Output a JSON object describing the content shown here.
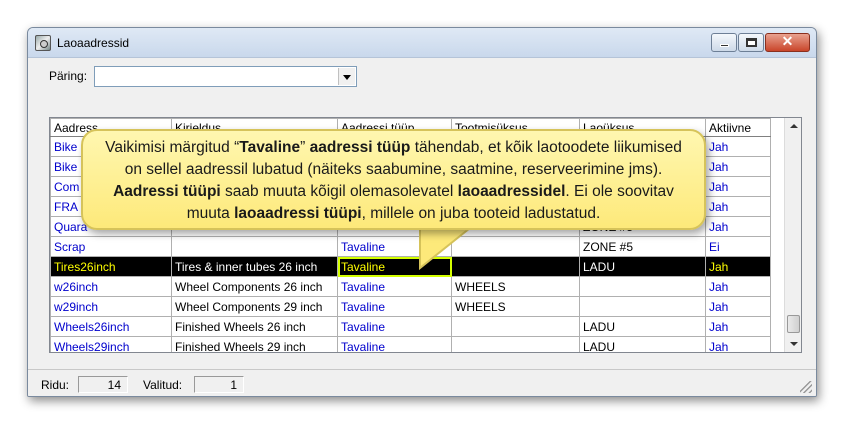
{
  "window": {
    "title": "Laoaadressid"
  },
  "query": {
    "label": "Päring:",
    "value": ""
  },
  "grid": {
    "columns": [
      "Aadress",
      "Kirjeldus",
      "Aadressi tüüp",
      "Tootmisüksus",
      "Laoüksus",
      "Aktiivne"
    ],
    "rows": [
      [
        "Bike",
        "",
        "",
        "",
        "",
        "Jah"
      ],
      [
        "Bike",
        "",
        "",
        "",
        "",
        "Jah"
      ],
      [
        "Com",
        "",
        "",
        "",
        "",
        "Jah"
      ],
      [
        "FRA",
        "",
        "",
        "",
        "",
        "Jah"
      ],
      [
        "Quara",
        "",
        "",
        "",
        "ZONE #5",
        "Jah"
      ],
      [
        "Scrap",
        "",
        "Tavaline",
        "",
        "ZONE #5",
        "Ei"
      ],
      [
        "Tires26inch",
        "Tires & inner tubes 26 inch",
        "Tavaline",
        "",
        "LADU",
        "Jah"
      ],
      [
        "w26inch",
        "Wheel Components 26 inch",
        "Tavaline",
        "WHEELS",
        "",
        "Jah"
      ],
      [
        "w29inch",
        "Wheel Components 29 inch",
        "Tavaline",
        "WHEELS",
        "",
        "Jah"
      ],
      [
        "Wheels26inch",
        "Finished Wheels 26 inch",
        "Tavaline",
        "",
        "LADU",
        "Jah"
      ],
      [
        "Wheels29inch",
        "Finished Wheels 29 inch",
        "Tavaline",
        "",
        "LADU",
        "Jah"
      ]
    ],
    "selected_row": 6
  },
  "callout": {
    "l1a": "Vaikimisi märgitud “",
    "l1b": "Tavaline",
    "l1c": "” ",
    "l1d": "aadressi tüüp",
    "l1e": " tähendab, et kõik laotoodete liikumised",
    "l2": "on sellel aadressil lubatud (näiteks saabumine, saatmine, reserveerimine jms).",
    "l3a": "Aadressi tüüpi",
    "l3b": " saab muuta kõigil olemasolevatel ",
    "l3c": "laoaadressidel",
    "l3d": ".  Ei ole soovitav",
    "l4a": "muuta ",
    "l4b": "laoaadressi tüüpi",
    "l4c": ", millele on juba tooteid ladustatud."
  },
  "status": {
    "rows_label": "Ridu:",
    "rows_value": "14",
    "selected_label": "Valitud:",
    "selected_value": "1"
  }
}
